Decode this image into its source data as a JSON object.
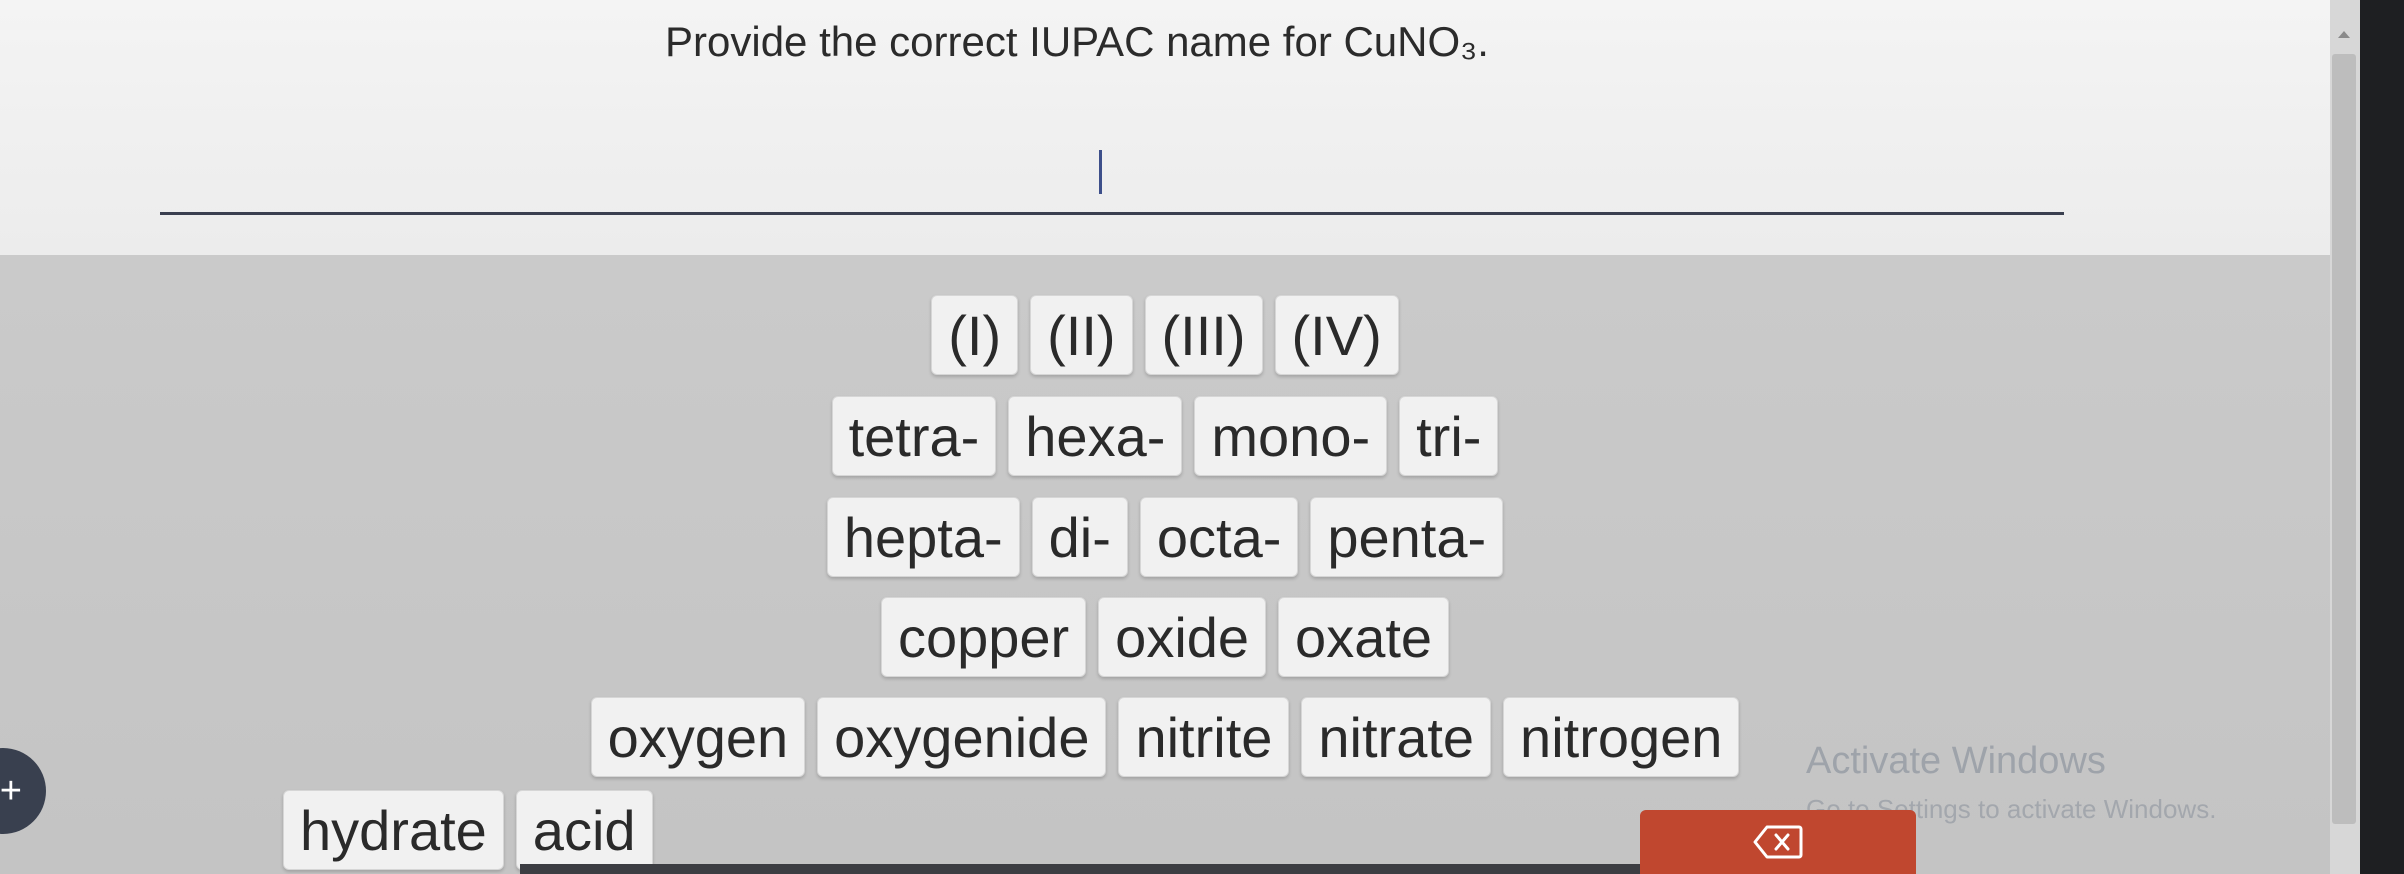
{
  "question": {
    "text": "Provide the correct IUPAC name for CuNO₃."
  },
  "answer": {
    "value": ""
  },
  "tiles": {
    "row1": [
      "(I)",
      "(II)",
      "(III)",
      "(IV)"
    ],
    "row2": [
      "tetra-",
      "hexa-",
      "mono-",
      "tri-"
    ],
    "row3": [
      "hepta-",
      "di-",
      "octa-",
      "penta-"
    ],
    "row4": [
      "copper",
      "oxide",
      "oxate"
    ],
    "row5": [
      "oxygen",
      "oxygenide",
      "nitrite",
      "nitrate",
      "nitrogen"
    ],
    "row6": [
      "hydrate",
      "acid"
    ]
  },
  "controls": {
    "add_icon": "plus-icon",
    "delete_icon": "backspace-icon",
    "delete_color": "#c0472f"
  },
  "watermark": {
    "title": "Activate Windows",
    "subtitle": "Go to Settings to activate Windows."
  }
}
